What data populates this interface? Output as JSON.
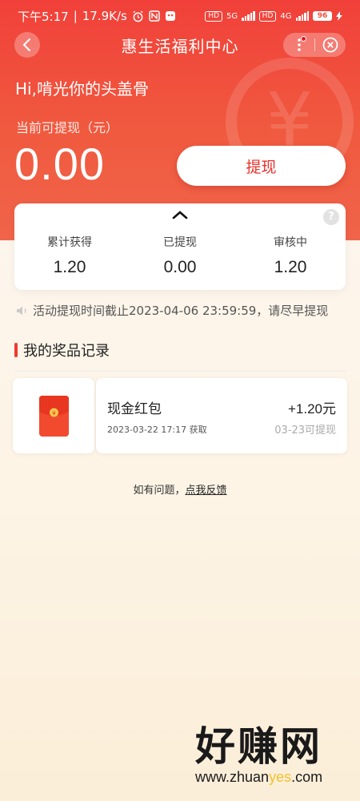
{
  "status_bar": {
    "time": "下午5:17",
    "speed": "17.9K/s",
    "network_1": "5G",
    "network_2": "4G",
    "hd_label": "HD",
    "battery": "96"
  },
  "navbar": {
    "title": "惠生活福利中心"
  },
  "hero": {
    "greeting": "Hi,啃光你的头盖骨",
    "balance_label": "当前可提现（元）",
    "balance": "0.00",
    "withdraw_label": "提现",
    "watermark_symbol": "¥"
  },
  "stats": {
    "help": "?",
    "items": [
      {
        "label": "累计获得",
        "value": "1.20"
      },
      {
        "label": "已提现",
        "value": "0.00"
      },
      {
        "label": "审核中",
        "value": "1.20"
      }
    ]
  },
  "notice": {
    "text": "活动提现时间截止2023-04-06 23:59:59，请尽早提现"
  },
  "records": {
    "title": "我的奖品记录",
    "items": [
      {
        "name": "现金红包",
        "date": "2023-03-22 17:17 获取",
        "amount": "+1.20元",
        "status": "03-23可提现"
      }
    ]
  },
  "feedback": {
    "prefix": "如有问题，",
    "link": "点我反馈"
  },
  "watermark": {
    "big": "好赚网",
    "small_prefix": "www.zhuan",
    "small_highlight": "yes",
    "small_suffix": ".com"
  },
  "colors": {
    "primary_red": "#f1403a",
    "accent_bar": "#f0392d",
    "withdraw_text": "#e8302a"
  }
}
